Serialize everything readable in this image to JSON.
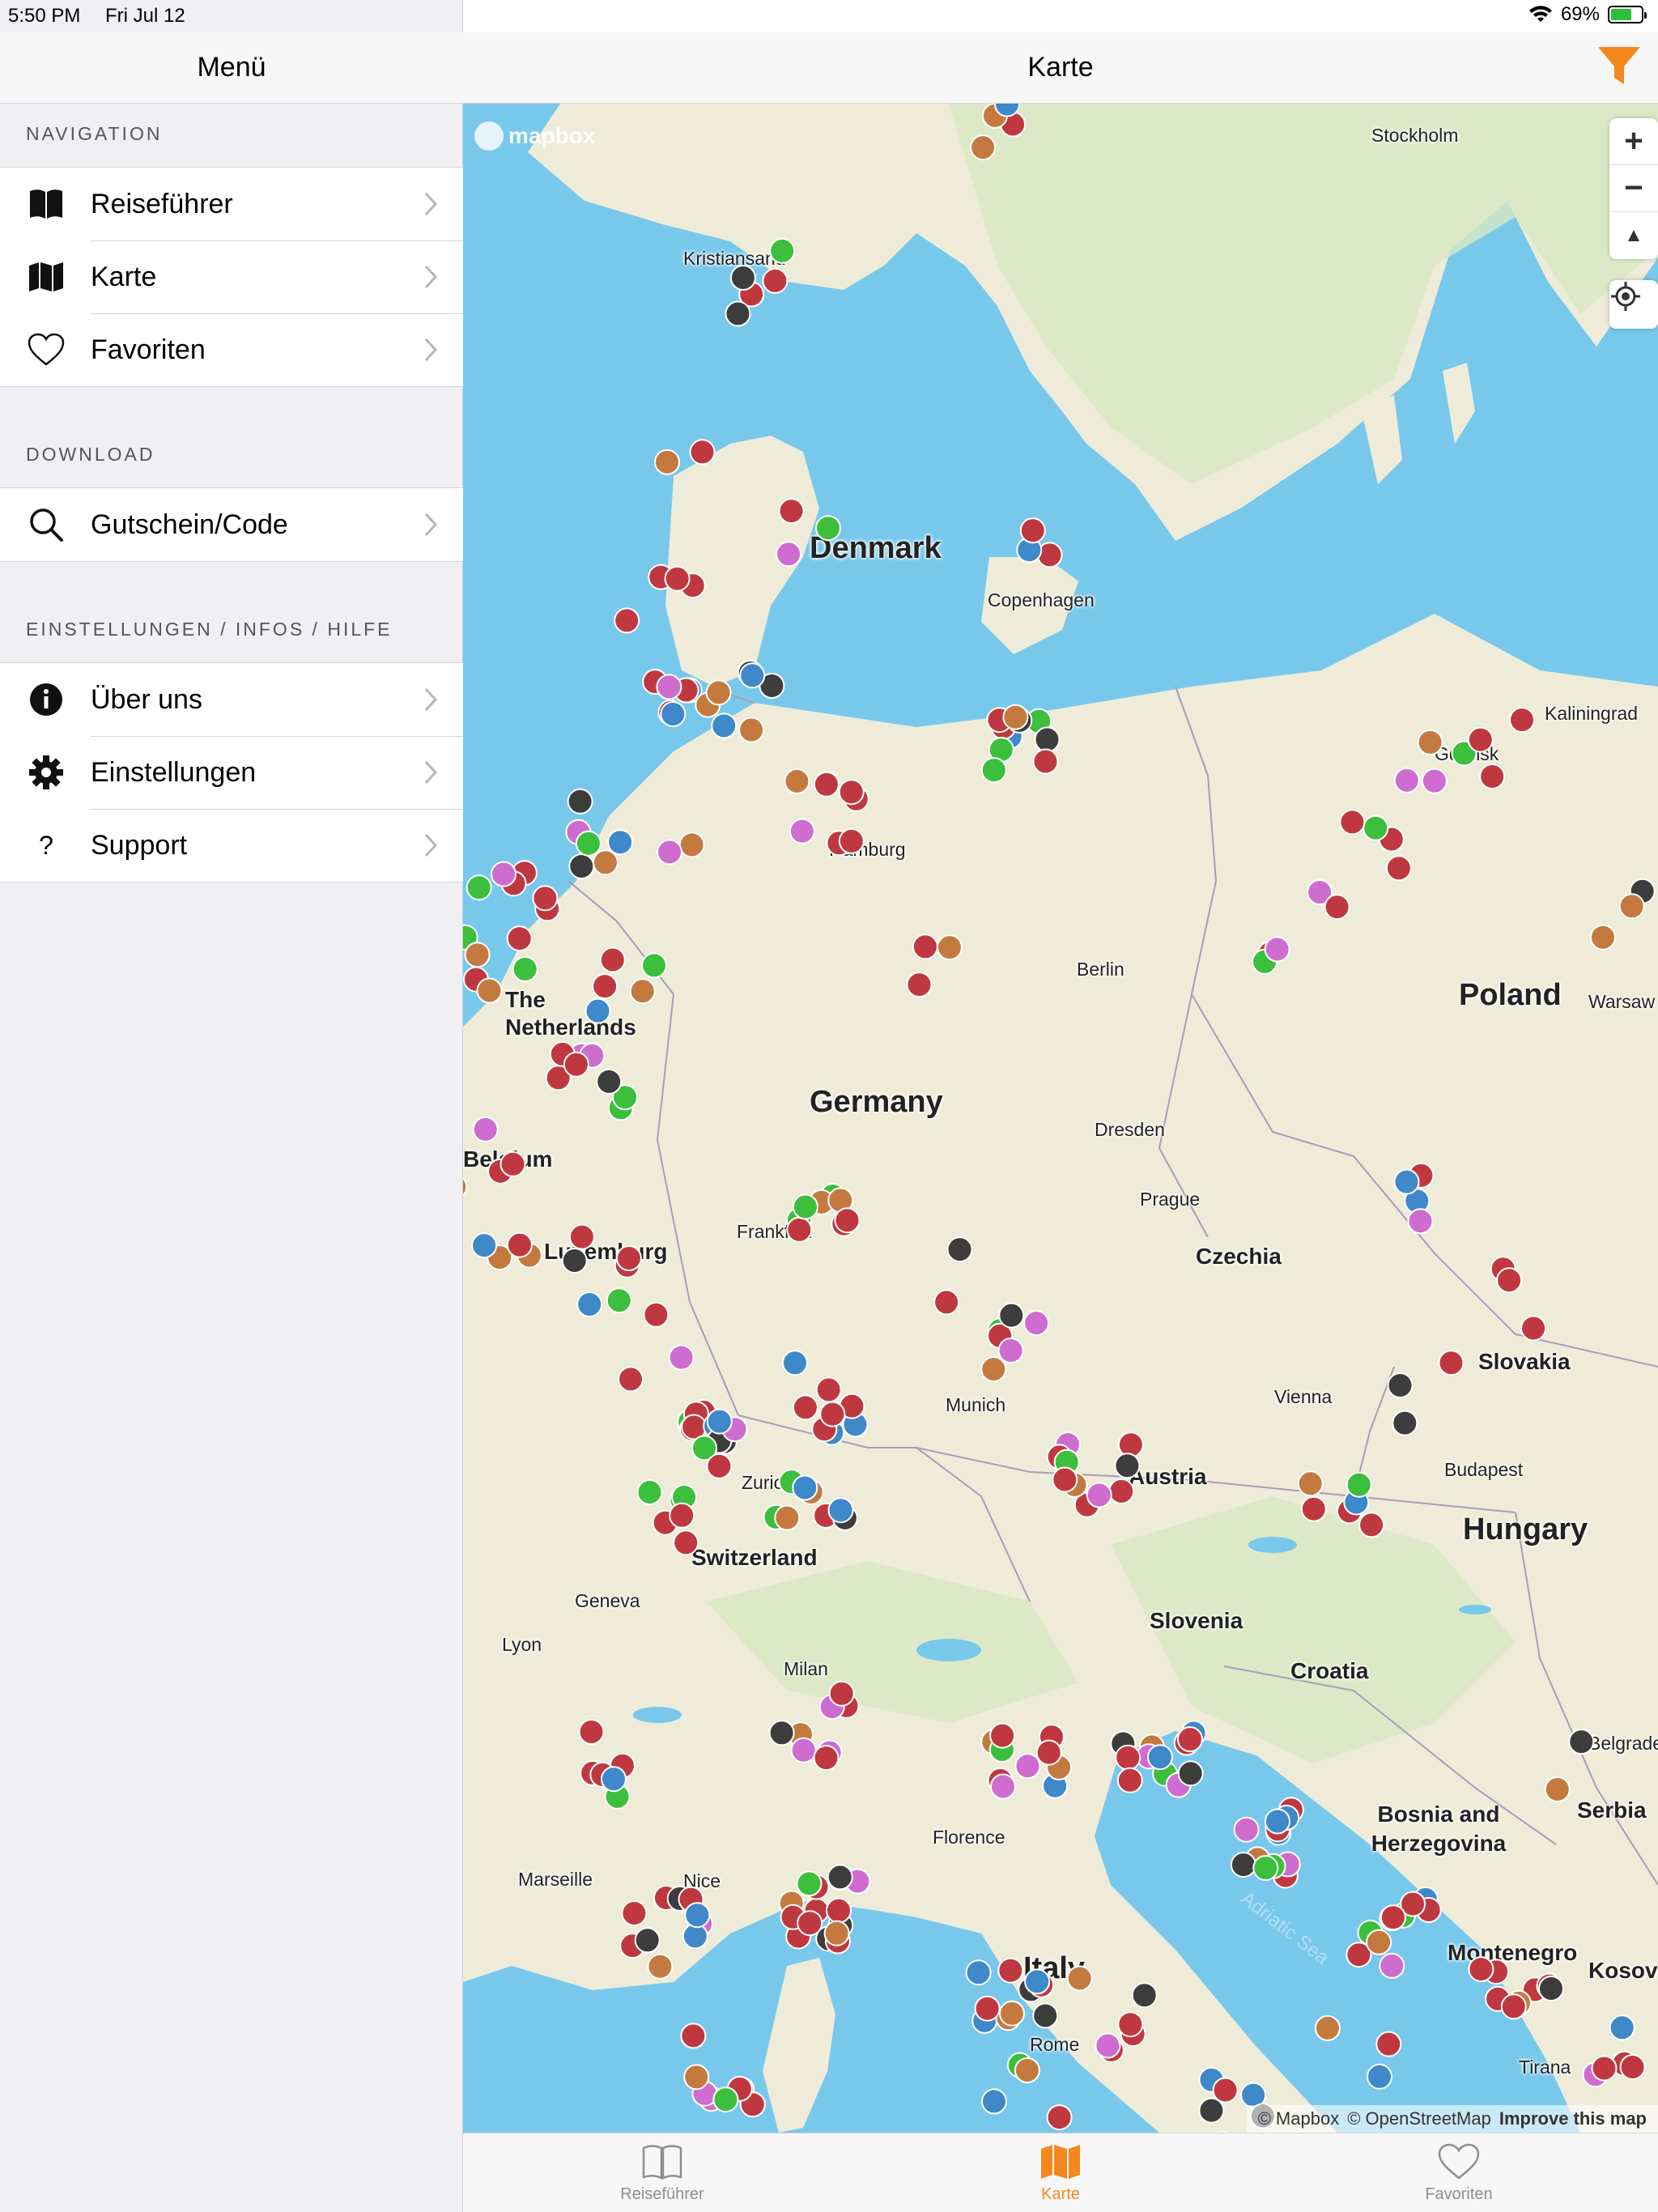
{
  "status_bar": {
    "time": "5:50 PM",
    "date": "Fri Jul 12",
    "battery": "69%",
    "battery_level": 0.69
  },
  "sidebar": {
    "title": "Menü",
    "sections": [
      {
        "label": "NAVIGATION",
        "items": [
          {
            "label": "Reiseführer",
            "icon": "book-icon"
          },
          {
            "label": "Karte",
            "icon": "map-icon"
          },
          {
            "label": "Favoriten",
            "icon": "heart-icon"
          }
        ]
      },
      {
        "label": "DOWNLOAD",
        "items": [
          {
            "label": "Gutschein/Code",
            "icon": "search-icon"
          }
        ]
      },
      {
        "label": "EINSTELLUNGEN / INFOS / HILFE",
        "items": [
          {
            "label": "Über uns",
            "icon": "info-icon"
          },
          {
            "label": "Einstellungen",
            "icon": "gear-icon"
          },
          {
            "label": "Support",
            "icon": "question-icon"
          }
        ]
      }
    ]
  },
  "main": {
    "title": "Karte",
    "accent_color": "#f5871f"
  },
  "map": {
    "logo": "mapbox",
    "countries": [
      "Denmark",
      "Germany",
      "Poland",
      "Czechia",
      "Slovakia",
      "Austria",
      "Hungary",
      "Switzerland",
      "Slovenia",
      "Croatia",
      "Bosnia and Herzegovina",
      "Serbia",
      "Montenegro",
      "Kosovo",
      "Italy",
      "Belgium",
      "The Netherlands",
      "Luxemburg"
    ],
    "cities": [
      "Stockholm",
      "Kristiansand",
      "Copenhagen",
      "Kaliningrad",
      "Gdansk",
      "Hamburg",
      "Berlin",
      "Warsaw",
      "Dresden",
      "Prague",
      "Frankfurt",
      "Munich",
      "Vienna",
      "Budapest",
      "Zurich",
      "Geneva",
      "Lyon",
      "Milan",
      "Florence",
      "Marseille",
      "Belgrade",
      "Rome",
      "Tirana",
      "Nice"
    ],
    "sea": "Adriatic Sea",
    "zoom_in": "+",
    "zoom_out": "−",
    "compass": "▲",
    "attribution": {
      "mapbox": "© Mapbox",
      "osm": "© OpenStreetMap",
      "improve": "Improve this map"
    },
    "marker_colors": {
      "red": "#c0383f",
      "green": "#3cbf3c",
      "brown": "#c47a3f",
      "purple": "#cf6ccf",
      "blue": "#3f88c9",
      "dark": "#3d3d3d",
      "magenta": "#b83ccf"
    }
  },
  "tabbar": {
    "tabs": [
      {
        "label": "Reiseführer",
        "icon": "book-icon",
        "active": false
      },
      {
        "label": "Karte",
        "icon": "map-icon",
        "active": true
      },
      {
        "label": "Favoriten",
        "icon": "heart-icon",
        "active": false
      }
    ]
  }
}
